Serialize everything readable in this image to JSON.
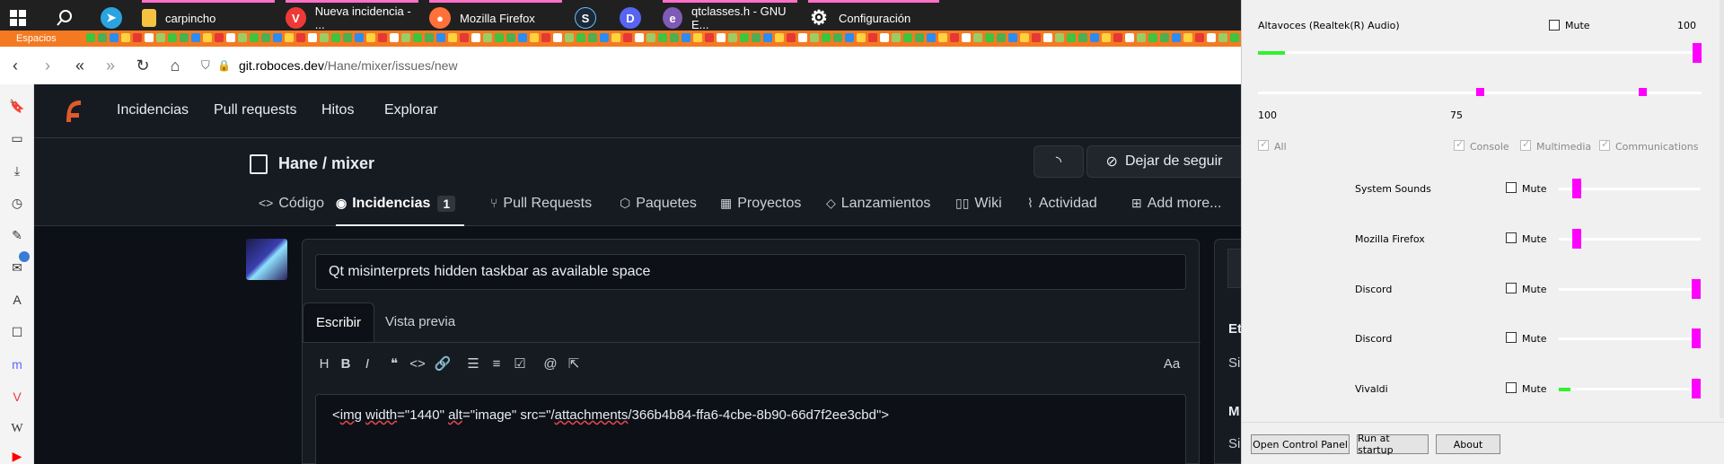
{
  "taskbar": {
    "apps": [
      {
        "label": "carpincho",
        "icon": "folder-icon",
        "color": "#f5c242"
      },
      {
        "label": "Nueva incidencia - ...",
        "icon": "vivaldi-icon",
        "color": "#ef3939"
      },
      {
        "label": "Mozilla Firefox",
        "icon": "firefox-icon",
        "color": "#ff7139"
      },
      {
        "label": "qtclasses.h - GNU E...",
        "icon": "emacs-icon",
        "color": "#7f5ab6"
      },
      {
        "label": "Configuración",
        "icon": "gear-icon",
        "color": "#ffffff"
      }
    ]
  },
  "bookmarks": {
    "spaces_label": "Espacios"
  },
  "browser": {
    "url_host": "git.roboces.dev",
    "url_path": "/Hane/mixer/issues/new"
  },
  "gitea": {
    "nav": [
      "Incidencias",
      "Pull requests",
      "Hitos",
      "Explorar"
    ],
    "repo": "Hane / mixer",
    "unwatch_label": "Dejar de seguir",
    "tabs": [
      {
        "label": "Código",
        "icon": "code-icon"
      },
      {
        "label": "Incidencias",
        "icon": "issue-icon",
        "count": "1"
      },
      {
        "label": "Pull Requests",
        "icon": "pull-request-icon"
      },
      {
        "label": "Paquetes",
        "icon": "package-icon"
      },
      {
        "label": "Proyectos",
        "icon": "project-icon"
      },
      {
        "label": "Lanzamientos",
        "icon": "tag-icon"
      },
      {
        "label": "Wiki",
        "icon": "book-icon"
      },
      {
        "label": "Actividad",
        "icon": "pulse-icon"
      },
      {
        "label": "Add more...",
        "icon": "plus-square-icon"
      }
    ],
    "issue_title": "Qt misinterprets hidden taskbar as available space",
    "editor_tabs": [
      "Escribir",
      "Vista previa"
    ],
    "text_size_toggle": "Aa",
    "body_text_parts": [
      "<",
      "img",
      " ",
      "width",
      "=\"1440\" ",
      "alt",
      "=\"image\" src=\"/",
      "attachments",
      "/366b4b84-ffa6-4cbe-8b90-66d7f2ee3cbd\">"
    ],
    "right_col_peek": [
      "Et",
      "Si",
      "M",
      "Si"
    ]
  },
  "mixer": {
    "device": "Altavoces (Realtek(R) Audio)",
    "mute_label": "Mute",
    "master_value": "100",
    "master_level": 0.06,
    "master_volume": 1.0,
    "balance_left_value": "100",
    "balance_right_value": "75",
    "balance_left": 0.5,
    "balance_right": 0.875,
    "filters": {
      "all": "All",
      "console": "Console",
      "multimedia": "Multimedia",
      "communications": "Communications"
    },
    "sessions": [
      {
        "name": "System Sounds",
        "volume": 0.1,
        "level": 0
      },
      {
        "name": "Mozilla Firefox",
        "volume": 0.1,
        "level": 0
      },
      {
        "name": "Discord",
        "volume": 1.0,
        "level": 0
      },
      {
        "name": "Discord",
        "volume": 1.0,
        "level": 0
      },
      {
        "name": "Vivaldi",
        "volume": 1.0,
        "level": 0.08
      }
    ],
    "buttons": {
      "control_panel": "Open Control Panel",
      "startup": "Run at startup",
      "about": "About"
    }
  }
}
